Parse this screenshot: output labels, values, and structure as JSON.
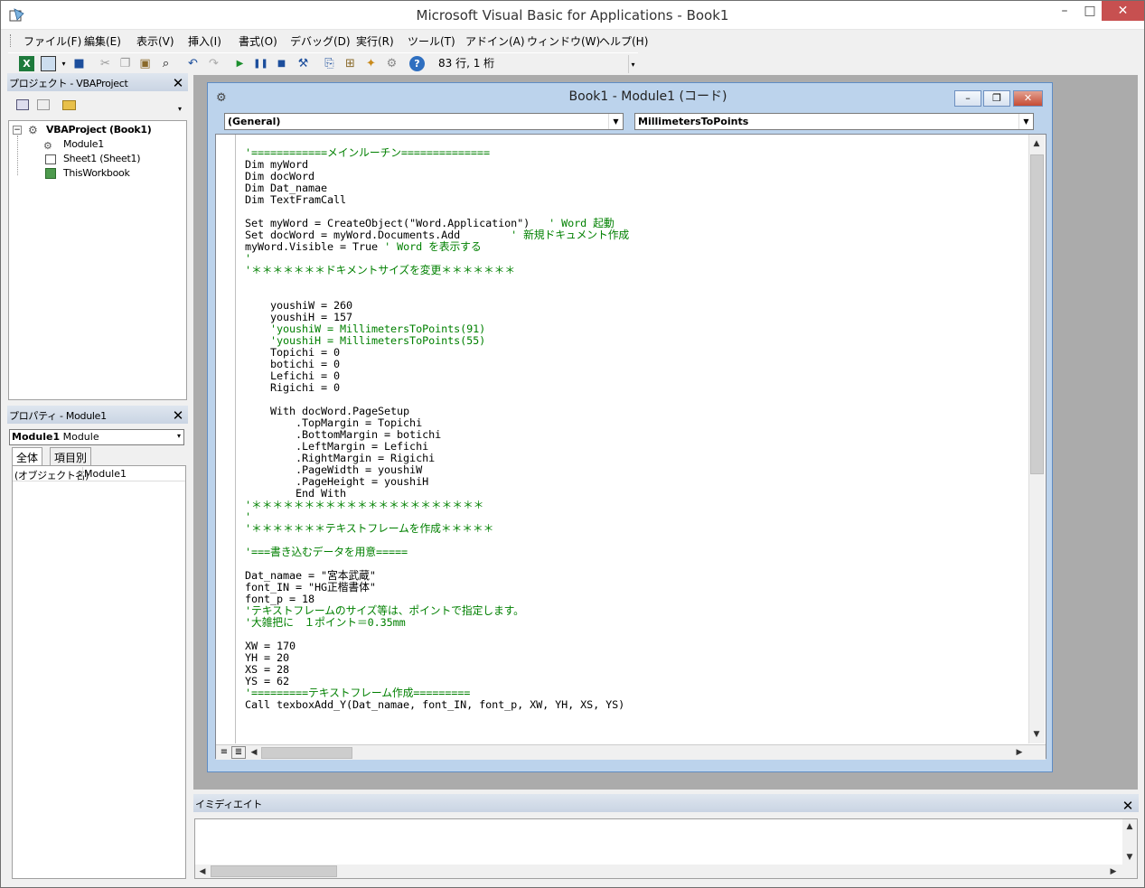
{
  "window": {
    "title": "Microsoft Visual Basic for Applications - Book1",
    "minimize": "–",
    "maximize": "□",
    "close": "✕"
  },
  "menu": [
    "ファイル(F)",
    "編集(E)",
    "表示(V)",
    "挿入(I)",
    "書式(O)",
    "デバッグ(D)",
    "実行(R)",
    "ツール(T)",
    "アドイン(A)",
    "ウィンドウ(W)",
    "ヘルプ(H)"
  ],
  "toolbar": {
    "position": "83 行, 1 桁"
  },
  "project_panel": {
    "title": "プロジェクト - VBAProject",
    "tree": {
      "root": "VBAProject (Book1)",
      "children": [
        "Module1",
        "Sheet1 (Sheet1)",
        "ThisWorkbook"
      ]
    }
  },
  "properties_panel": {
    "title": "プロパティ - Module1",
    "object": "Module1",
    "object_type": "Module",
    "tabs": [
      "全体",
      "項目別"
    ],
    "row_name": "(オブジェクト名)",
    "row_value": "Module1"
  },
  "code_window": {
    "title": "Book1 - Module1 (コード)",
    "object_combo": "(General)",
    "proc_combo": "MillimetersToPoints",
    "lines": [
      [
        {
          "t": "'============メインルーチン==============",
          "c": "cm"
        }
      ],
      [
        {
          "t": "Dim myWord",
          "c": ""
        }
      ],
      [
        {
          "t": "Dim docWord",
          "c": ""
        }
      ],
      [
        {
          "t": "Dim Dat_namae",
          "c": ""
        }
      ],
      [
        {
          "t": "Dim TextFramCall",
          "c": ""
        }
      ],
      [
        {
          "t": "",
          "c": ""
        }
      ],
      [
        {
          "t": "Set myWord = CreateObject(\"Word.Application\")   ",
          "c": ""
        },
        {
          "t": "' Word 起動",
          "c": "cm"
        }
      ],
      [
        {
          "t": "Set docWord = myWord.Documents.Add        ",
          "c": ""
        },
        {
          "t": "' 新規ドキュメント作成",
          "c": "cm"
        }
      ],
      [
        {
          "t": "myWord.Visible = True ",
          "c": ""
        },
        {
          "t": "' Word を表示する",
          "c": "cm"
        }
      ],
      [
        {
          "t": "'",
          "c": "cm"
        }
      ],
      [
        {
          "t": "'＊＊＊＊＊＊＊ドキメントサイズを変更＊＊＊＊＊＊＊",
          "c": "cm"
        }
      ],
      [
        {
          "t": "",
          "c": ""
        }
      ],
      [
        {
          "t": "",
          "c": ""
        }
      ],
      [
        {
          "t": "    youshiW = 260",
          "c": ""
        }
      ],
      [
        {
          "t": "    youshiH = 157",
          "c": ""
        }
      ],
      [
        {
          "t": "    'youshiW = MillimetersToPoints(91)",
          "c": "cm"
        }
      ],
      [
        {
          "t": "    'youshiH = MillimetersToPoints(55)",
          "c": "cm"
        }
      ],
      [
        {
          "t": "    Topichi = 0",
          "c": ""
        }
      ],
      [
        {
          "t": "    botichi = 0",
          "c": ""
        }
      ],
      [
        {
          "t": "    Lefichi = 0",
          "c": ""
        }
      ],
      [
        {
          "t": "    Rigichi = 0",
          "c": ""
        }
      ],
      [
        {
          "t": "",
          "c": ""
        }
      ],
      [
        {
          "t": "    With docWord.PageSetup",
          "c": ""
        }
      ],
      [
        {
          "t": "        .TopMargin = Topichi",
          "c": ""
        }
      ],
      [
        {
          "t": "        .BottomMargin = botichi",
          "c": ""
        }
      ],
      [
        {
          "t": "        .LeftMargin = Lefichi",
          "c": ""
        }
      ],
      [
        {
          "t": "        .RightMargin = Rigichi",
          "c": ""
        }
      ],
      [
        {
          "t": "        .PageWidth = youshiW",
          "c": ""
        }
      ],
      [
        {
          "t": "        .PageHeight = youshiH",
          "c": ""
        }
      ],
      [
        {
          "t": "        End With",
          "c": ""
        }
      ],
      [
        {
          "t": "'＊＊＊＊＊＊＊＊＊＊＊＊＊＊＊＊＊＊＊＊＊＊",
          "c": "cm"
        }
      ],
      [
        {
          "t": "'",
          "c": "cm"
        }
      ],
      [
        {
          "t": "'＊＊＊＊＊＊＊テキストフレームを作成＊＊＊＊＊",
          "c": "cm"
        }
      ],
      [
        {
          "t": "",
          "c": ""
        }
      ],
      [
        {
          "t": "'===書き込むデータを用意=====",
          "c": "cm"
        }
      ],
      [
        {
          "t": "",
          "c": ""
        }
      ],
      [
        {
          "t": "Dat_namae = \"宮本武蔵\"",
          "c": ""
        }
      ],
      [
        {
          "t": "font_IN = \"HG正楷書体\"",
          "c": ""
        }
      ],
      [
        {
          "t": "font_p = 18",
          "c": ""
        }
      ],
      [
        {
          "t": "'テキストフレームのサイズ等は、ポイントで指定します。",
          "c": "cm"
        }
      ],
      [
        {
          "t": "'大雑把に　１ポイント＝0.35mm",
          "c": "cm"
        }
      ],
      [
        {
          "t": "",
          "c": ""
        }
      ],
      [
        {
          "t": "XW = 170",
          "c": ""
        }
      ],
      [
        {
          "t": "YH = 20",
          "c": ""
        }
      ],
      [
        {
          "t": "XS = 28",
          "c": ""
        }
      ],
      [
        {
          "t": "YS = 62",
          "c": ""
        }
      ],
      [
        {
          "t": "'=========テキストフレーム作成=========",
          "c": "cm"
        }
      ],
      [
        {
          "t": "Call texboxAdd_Y(Dat_namae, font_IN, font_p, XW, YH, XS, YS)",
          "c": ""
        }
      ]
    ]
  },
  "immediate_panel": {
    "title": "イミディエイト"
  },
  "colors": {
    "comment": "#008000",
    "mdi_background": "#ababab",
    "code_window_frame": "#bcd3ec"
  }
}
